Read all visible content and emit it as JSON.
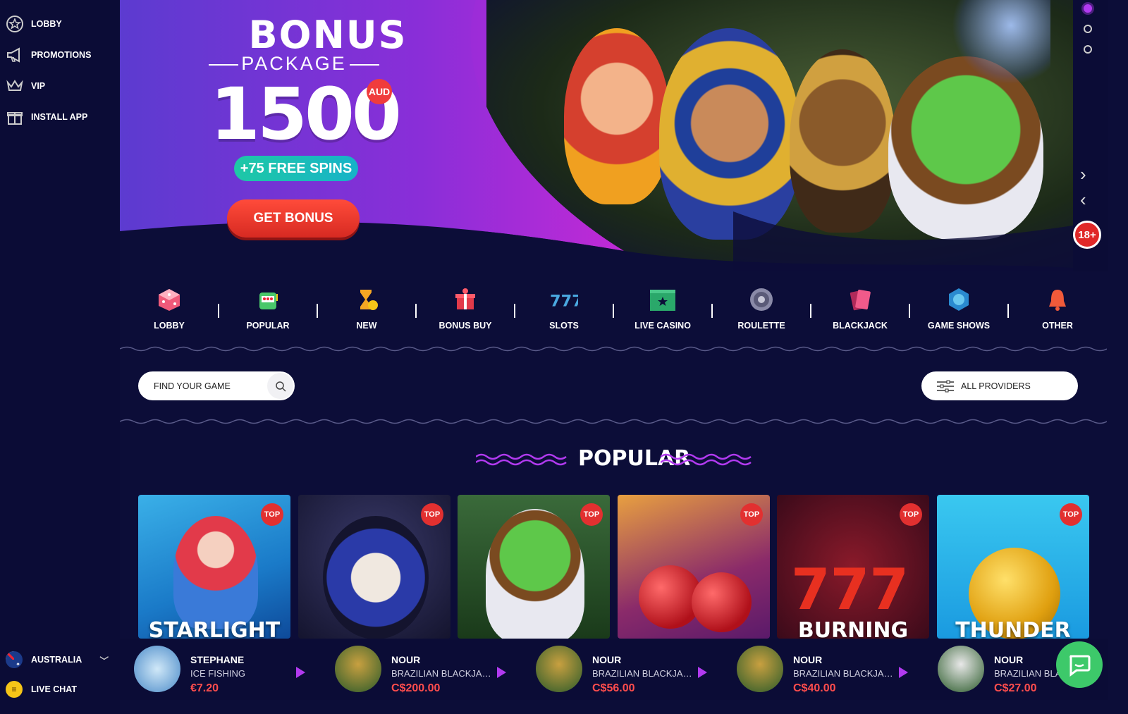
{
  "sidebar": {
    "items": [
      {
        "label": "LOBBY",
        "icon": "star-badge-icon"
      },
      {
        "label": "PROMOTIONS",
        "icon": "megaphone-icon"
      },
      {
        "label": "VIP",
        "icon": "crown-icon"
      },
      {
        "label": "INSTALL APP",
        "icon": "gift-icon"
      }
    ],
    "country": "AUSTRALIA",
    "live_chat": "LIVE CHAT"
  },
  "hero": {
    "title": "BONUS",
    "subtitle": "PACKAGE",
    "amount": "1500",
    "currency": "AUD",
    "spins": "+75 FREE SPINS",
    "cta": "GET BONUS",
    "age": "18+"
  },
  "categories": [
    {
      "label": "LOBBY",
      "icon": "dice-icon"
    },
    {
      "label": "POPULAR",
      "icon": "slot-machine-icon"
    },
    {
      "label": "NEW",
      "icon": "hourglass-icon"
    },
    {
      "label": "BONUS BUY",
      "icon": "gift-box-icon"
    },
    {
      "label": "SLOTS",
      "icon": "triple-seven-icon"
    },
    {
      "label": "LIVE CASINO",
      "icon": "live-table-icon"
    },
    {
      "label": "ROULETTE",
      "icon": "roulette-icon"
    },
    {
      "label": "BLACKJACK",
      "icon": "cards-icon"
    },
    {
      "label": "GAME SHOWS",
      "icon": "wheel-icon"
    },
    {
      "label": "OTHER",
      "icon": "bell-icon"
    }
  ],
  "search": {
    "placeholder": "FIND YOUR GAME"
  },
  "providers": {
    "label": "ALL PROVIDERS"
  },
  "section_title": "POPULAR",
  "games": [
    {
      "name": "STARLIGHT",
      "badge": "TOP"
    },
    {
      "name": "",
      "badge": "TOP"
    },
    {
      "name": "",
      "badge": "TOP"
    },
    {
      "name": "",
      "badge": "TOP"
    },
    {
      "name": "BURNING",
      "badge": "TOP"
    },
    {
      "name": "THUNDER",
      "badge": "TOP"
    }
  ],
  "winners": [
    {
      "user": "STEPHANE",
      "game": "ICE FISHING",
      "amount": "€7.20"
    },
    {
      "user": "NOUR",
      "game": "BRAZILIAN BLACKJACK",
      "amount": "C$200.00"
    },
    {
      "user": "NOUR",
      "game": "BRAZILIAN BLACKJACK",
      "amount": "C$56.00"
    },
    {
      "user": "NOUR",
      "game": "BRAZILIAN BLACKJACK",
      "amount": "C$40.00"
    },
    {
      "user": "NOUR",
      "game": "BRAZILIAN BLACKJACK",
      "amount": "C$27.00"
    }
  ],
  "colors": {
    "accent": "#b23af0",
    "cta": "#ff4b3a",
    "background": "#0c0d38",
    "spins": "#1ec8a6"
  }
}
